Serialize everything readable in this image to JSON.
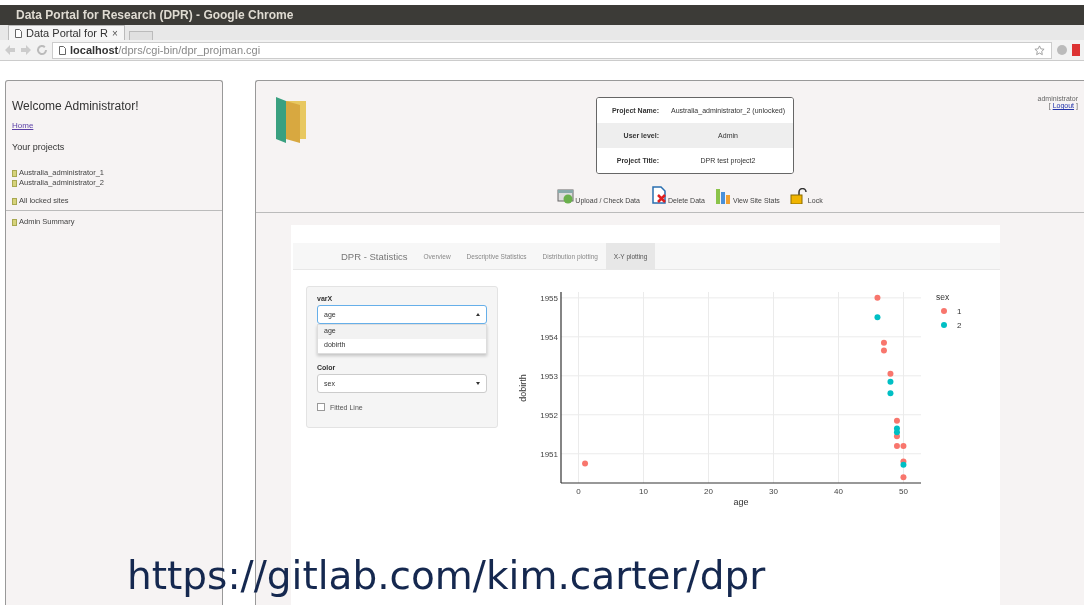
{
  "window": {
    "title": "Data Portal for Research (DPR) - Google Chrome"
  },
  "browser_tab": {
    "label": "Data Portal for R",
    "close": "×"
  },
  "address_bar": {
    "host": "localhost",
    "path": "/dprs/cgi-bin/dpr_projman.cgi"
  },
  "sidebar": {
    "heading": "Welcome Administrator!",
    "home_link": "Home",
    "projects_heading": "Your projects",
    "projects": [
      "Australia_administrator_1",
      "Australia_administrator_2"
    ],
    "locked_link": "All locked sites",
    "admin_link": "Admin Summary"
  },
  "project_info": [
    {
      "label": "Project Name:",
      "value": "Australia_administrator_2 (unlocked)"
    },
    {
      "label": "User level:",
      "value": "Admin"
    },
    {
      "label": "Project Title:",
      "value": "DPR test project2"
    }
  ],
  "user": {
    "name": "administrator",
    "open": "[",
    "logout": "Logout",
    "close": "]"
  },
  "actions": [
    {
      "label": "Upload / Check Data",
      "kind": "upload"
    },
    {
      "label": "Delete Data",
      "kind": "delete"
    },
    {
      "label": "View Site Stats",
      "kind": "stats"
    },
    {
      "label": "Lock",
      "kind": "lock"
    }
  ],
  "app": {
    "brand": "DPR - Statistics",
    "tabs": [
      {
        "label": "Overview",
        "selected": false
      },
      {
        "label": "Descriptive Statistics",
        "selected": false
      },
      {
        "label": "Distribution plotting",
        "selected": false
      },
      {
        "label": "X-Y plotting",
        "selected": true
      }
    ]
  },
  "controls": {
    "varx": {
      "label": "varX",
      "value": "age",
      "expanded": true,
      "options": [
        {
          "label": "age",
          "selected": true
        },
        {
          "label": "dobirth",
          "selected": false
        }
      ]
    },
    "color": {
      "label": "Color",
      "value": "sex",
      "expanded": false
    },
    "fitted_line": {
      "label": "Fitted Line",
      "checked": false
    }
  },
  "chart_data": {
    "type": "scatter",
    "xlabel": "age",
    "ylabel": "dobirth",
    "legend": {
      "title": "sex"
    },
    "xticks": [
      0,
      10,
      20,
      30,
      40,
      50
    ],
    "yticks": [
      1951,
      1952,
      1953,
      1954,
      1955
    ],
    "xlim": [
      -2.7,
      52.7
    ],
    "ylim": [
      1950.25,
      1955.15
    ],
    "grid": true,
    "series": [
      {
        "name": "1",
        "color": "#f8766d",
        "x": [
          1,
          46,
          47,
          47,
          48,
          49,
          49,
          49,
          50,
          50,
          50
        ],
        "values": [
          1950.75,
          1955.0,
          1953.85,
          1953.65,
          1953.05,
          1951.85,
          1951.45,
          1951.2,
          1951.2,
          1950.8,
          1950.4
        ]
      },
      {
        "name": "2",
        "color": "#00bfc4",
        "x": [
          46,
          48,
          48,
          49,
          49,
          50
        ],
        "values": [
          1954.5,
          1952.85,
          1952.55,
          1951.65,
          1951.55,
          1950.72
        ]
      }
    ]
  },
  "caption": "https://gitlab.com/kim.carter/dpr"
}
